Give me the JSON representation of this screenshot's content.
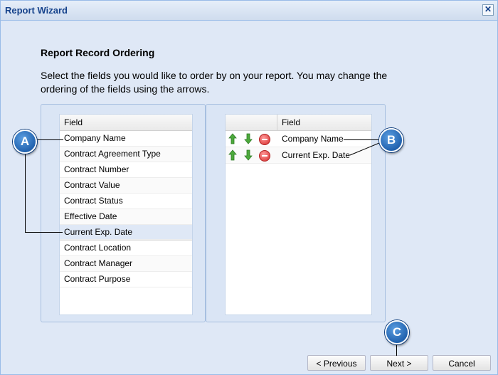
{
  "window": {
    "title": "Report Wizard",
    "close_icon": "close-icon"
  },
  "content": {
    "heading": "Report Record Ordering",
    "description": "Select the fields you would like to order by on your report. You may change the ordering of the fields using the arrows."
  },
  "left_grid": {
    "header": "Field",
    "items": [
      "Company Name",
      "Contract Agreement Type",
      "Contract Number",
      "Contract Value",
      "Contract Status",
      "Effective Date",
      "Current Exp. Date",
      "Contract Location",
      "Contract Manager",
      "Contract Purpose"
    ]
  },
  "right_grid": {
    "header": "Field",
    "items": [
      "Company Name",
      "Current Exp. Date"
    ]
  },
  "callouts": {
    "a": "A",
    "b": "B",
    "c": "C"
  },
  "buttons": {
    "previous": "< Previous",
    "next": "Next >",
    "cancel": "Cancel"
  },
  "colors": {
    "title": "#15428b",
    "background": "#dfe8f6",
    "callout": "#0a4a9a"
  }
}
